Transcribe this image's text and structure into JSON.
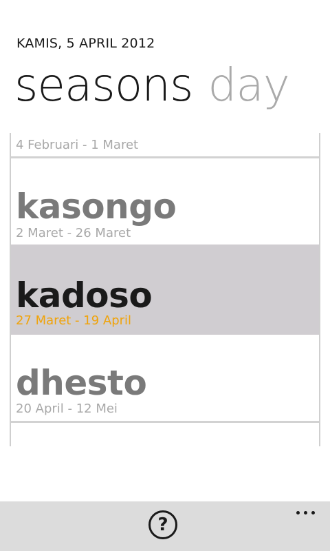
{
  "header": {
    "date": "KAMIS, 5 APRIL 2012"
  },
  "pivot": {
    "active": "seasons",
    "inactive": "day"
  },
  "seasons": [
    {
      "name": "",
      "range": "4 Februari - 1 Maret"
    },
    {
      "name": "kasongo",
      "range": "2 Maret - 26 Maret"
    },
    {
      "name": "kadoso",
      "range": "27 Maret - 19 April",
      "current": true
    },
    {
      "name": "dhesto",
      "range": "20 April - 12 Mei"
    }
  ],
  "app_bar": {
    "help_icon": "question-circle-icon",
    "help_glyph": "?",
    "more_icon": "ellipsis-icon"
  },
  "colors": {
    "accent": "#f0a30a",
    "highlight": "#d0cdd1",
    "app_bar": "#dcdcdc"
  }
}
